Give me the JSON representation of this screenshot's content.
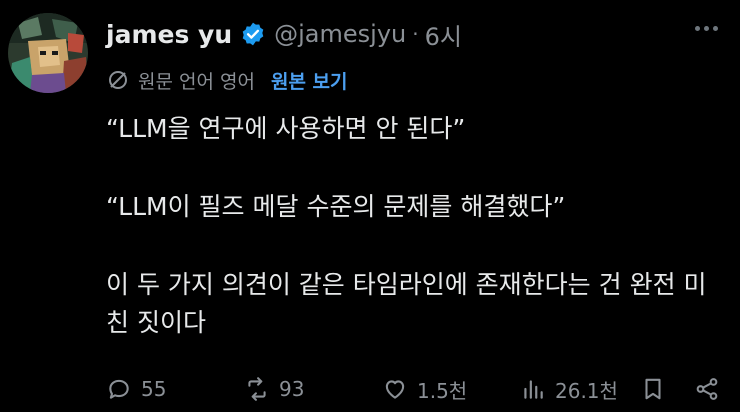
{
  "author": {
    "name": "james yu",
    "handle": "@jamesjyu",
    "separator": "·",
    "time": "6시"
  },
  "translation": {
    "note": "원문 언어 영어",
    "link": "원본 보기"
  },
  "tweet": {
    "paragraphs": [
      "“LLM을 연구에 사용하면 안 된다”",
      "“LLM이 필즈 메달 수준의 문제를 해결했다”",
      "이 두 가지 의견이 같은 타임라인에 존재한다는 건 완전 미친 짓이다"
    ]
  },
  "actions": {
    "replies": "55",
    "reposts": "93",
    "likes": "1.5천",
    "views": "26.1천"
  },
  "colors": {
    "background": "#000000",
    "text": "#e7e9ea",
    "muted": "#8b9096",
    "link": "#4c9ff0",
    "verified": "#1d9bf0"
  }
}
